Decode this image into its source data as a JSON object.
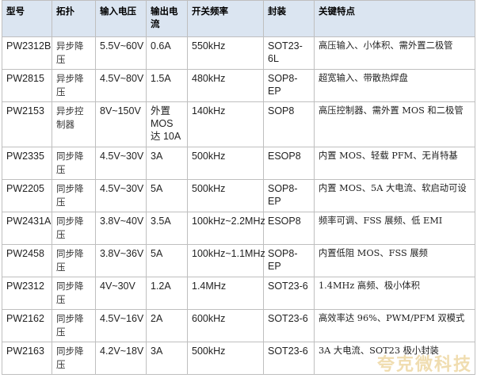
{
  "table": {
    "headers": [
      "型号",
      "拓扑",
      "输入电压",
      "输出电流",
      "开关频率",
      "封装",
      "关键特点"
    ],
    "rows": [
      {
        "model": "PW2312B",
        "topology": "异步降压",
        "vin": "5.5V~60V",
        "iout": "0.6A",
        "freq": "550kHz",
        "package": "SOT23-6L",
        "features": "高压输入、小体积、需外置二极管"
      },
      {
        "model": "PW2815",
        "topology": "异步降压",
        "vin": "4.5V~80V",
        "iout": "1.5A",
        "freq": "480kHz",
        "package": "SOP8-EP",
        "features": "超宽输入、带散热焊盘"
      },
      {
        "model": "PW2153",
        "topology": "异步控制器",
        "vin": "8V~150V",
        "iout": "外置 MOS 达 10A",
        "freq": "140kHz",
        "package": "SOP8",
        "features": "高压控制器、需外置 MOS 和二极管"
      },
      {
        "model": "PW2335",
        "topology": "同步降压",
        "vin": "4.5V~30V",
        "iout": "3A",
        "freq": "500kHz",
        "package": "ESOP8",
        "features": "内置 MOS、轻载 PFM、无肖特基"
      },
      {
        "model": "PW2205",
        "topology": "同步降压",
        "vin": "4.5V~30V",
        "iout": "5A",
        "freq": "500kHz",
        "package": "SOP8-EP",
        "features": "内置 MOS、5A 大电流、软启动可设"
      },
      {
        "model": "PW2431A",
        "topology": "同步降压",
        "vin": "3.8V~40V",
        "iout": "3.5A",
        "freq": "100kHz~2.2MHz",
        "package": "ESOP8",
        "features": "频率可调、FSS 展频、低 EMI"
      },
      {
        "model": "PW2458",
        "topology": "同步降压",
        "vin": "3.8V~36V",
        "iout": "5A",
        "freq": "100kHz~1.1MHz",
        "package": "SOP8-EP",
        "features": "内置低阻 MOS、FSS 展频"
      },
      {
        "model": "PW2312",
        "topology": "同步降压",
        "vin": "4V~30V",
        "iout": "1.2A",
        "freq": "1.4MHz",
        "package": "SOT23-6",
        "features": "1.4MHz 高频、极小体积"
      },
      {
        "model": "PW2162",
        "topology": "同步降压",
        "vin": "4.5V~16V",
        "iout": "2A",
        "freq": "600kHz",
        "package": "SOT23-6",
        "features": "高效率达 96%、PWM/PFM 双模式"
      },
      {
        "model": "PW2163",
        "topology": "同步降压",
        "vin": "4.2V~18V",
        "iout": "3A",
        "freq": "500kHz",
        "package": "SOT23-6",
        "features": "3A 大电流、SOT23 极小封装"
      }
    ]
  },
  "watermark": "夸克微科技"
}
